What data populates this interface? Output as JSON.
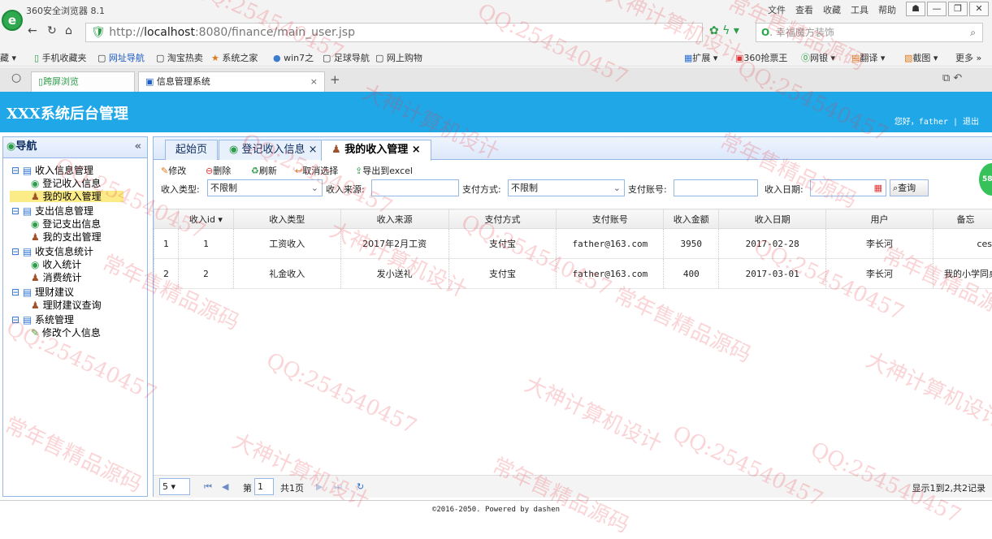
{
  "browser": {
    "title": "360安全浏览器 8.1",
    "menu": [
      "文件",
      "查看",
      "收藏",
      "工具",
      "帮助"
    ],
    "window_buttons": [
      "☗",
      "—",
      "❐",
      "✕"
    ],
    "url_scheme": "http://",
    "url_host": "localhost",
    "url_rest": ":8080/finance/main_user.jsp",
    "search_placeholder": "幸福魔方装饰",
    "bookmarks": [
      "藏 ▾",
      "手机收藏夹",
      "网址导航",
      "淘宝热卖",
      "系统之家",
      "win7之",
      "足球导航",
      "网上购物"
    ],
    "extensions": [
      "扩展 ▾",
      "360抢票王",
      "网银 ▾",
      "翻译 ▾",
      "截图 ▾",
      "更多 »"
    ],
    "tabs": [
      "跨屏浏览",
      "信息管理系统"
    ],
    "tab_close": "×",
    "new_tab": "+"
  },
  "app": {
    "title": "XXX系统后台管理",
    "greeting": "您好，father | 退出"
  },
  "sidebar": {
    "title": "导航",
    "collapse": "«",
    "tree": [
      {
        "label": "收入信息管理",
        "type": "folder"
      },
      {
        "label": "登记收入信息",
        "type": "add"
      },
      {
        "label": "我的收入管理",
        "type": "user",
        "selected": true
      },
      {
        "label": "支出信息管理",
        "type": "folder"
      },
      {
        "label": "登记支出信息",
        "type": "add"
      },
      {
        "label": "我的支出管理",
        "type": "user"
      },
      {
        "label": "收支信息统计",
        "type": "folder"
      },
      {
        "label": "收入统计",
        "type": "add"
      },
      {
        "label": "消费统计",
        "type": "user"
      },
      {
        "label": "理财建议",
        "type": "folder"
      },
      {
        "label": "理财建议查询",
        "type": "user"
      },
      {
        "label": "系统管理",
        "type": "folder"
      },
      {
        "label": "修改个人信息",
        "type": "edit"
      }
    ]
  },
  "main": {
    "tabs": [
      "起始页",
      "登记收入信息 ×",
      "我的收入管理 ×"
    ],
    "toolbar": [
      "修改",
      "删除",
      "刷新",
      "取消选择",
      "导出到excel"
    ],
    "filters": {
      "type_label": "收入类型:",
      "type_value": "不限制",
      "source_label": "收入来源:",
      "paymethod_label": "支付方式:",
      "paymethod_value": "不限制",
      "account_label": "支付账号:",
      "date_label": "收入日期:",
      "query": "查询"
    },
    "columns": [
      "收入id ▾",
      "收入类型",
      "收入来源",
      "支付方式",
      "支付账号",
      "收入金额",
      "收入日期",
      "用户",
      "备忘"
    ],
    "rows": [
      {
        "n": "1",
        "id": "1",
        "type": "工资收入",
        "source": "2017年2月工资",
        "method": "支付宝",
        "account": "father@163.com",
        "amount": "3950",
        "date": "2017-02-28",
        "user": "李长河",
        "memo": "cesh"
      },
      {
        "n": "2",
        "id": "2",
        "type": "礼金收入",
        "source": "发小送礼",
        "method": "支付宝",
        "account": "father@163.com",
        "amount": "400",
        "date": "2017-03-01",
        "user": "李长河",
        "memo": "我的小学同桌"
      }
    ],
    "pager": {
      "page_size": "5 ▾",
      "page_prefix": "第",
      "page_value": "1",
      "page_suffix": "共1页",
      "info": "显示1到2,共2记录"
    }
  },
  "footer": "©2016-2050. Powered by dashen",
  "badge": "58",
  "watermarks": [
    "QQ:254540457",
    "大神计算机设计",
    "常年售精品源码"
  ]
}
